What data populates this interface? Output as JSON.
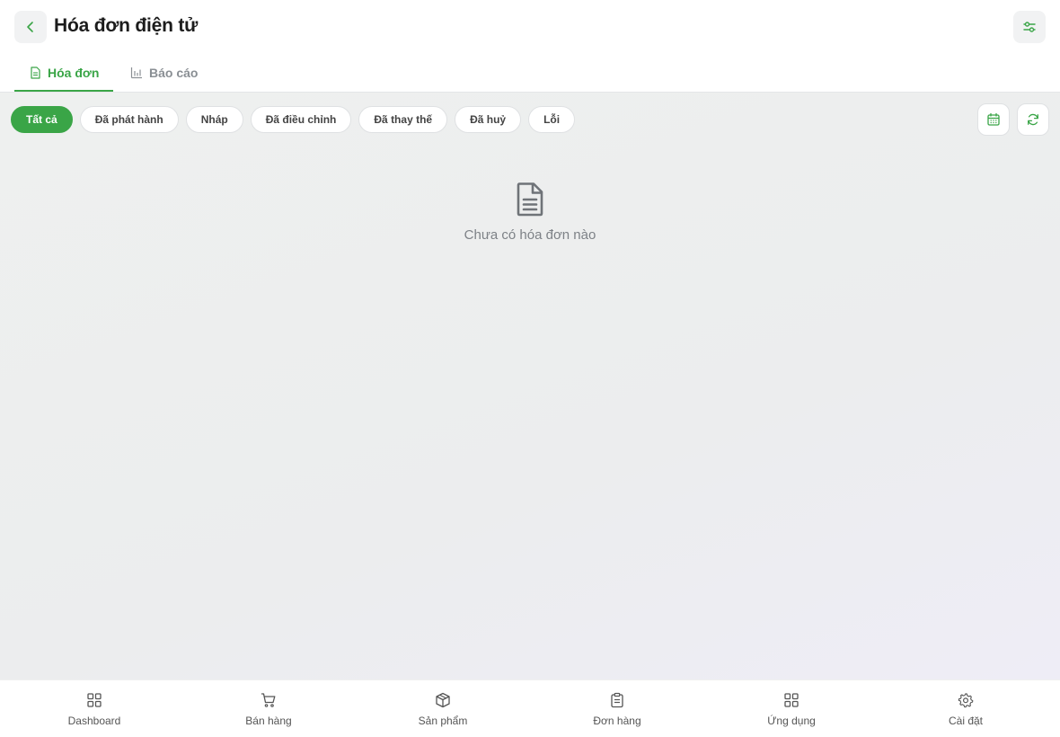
{
  "header": {
    "title": "Hóa đơn điện tử",
    "back_icon": "chevron-left-icon",
    "filter_icon": "sliders-icon"
  },
  "tabs": [
    {
      "label": "Hóa đơn",
      "icon": "document-icon",
      "active": true
    },
    {
      "label": "Báo cáo",
      "icon": "bar-chart-icon",
      "active": false
    }
  ],
  "filters": [
    {
      "label": "Tất cả",
      "active": true
    },
    {
      "label": "Đã phát hành",
      "active": false
    },
    {
      "label": "Nháp",
      "active": false
    },
    {
      "label": "Đã điều chỉnh",
      "active": false
    },
    {
      "label": "Đã thay thế",
      "active": false
    },
    {
      "label": "Đã huỷ",
      "active": false
    },
    {
      "label": "Lỗi",
      "active": false
    }
  ],
  "tools": {
    "calendar_icon": "calendar-icon",
    "refresh_icon": "refresh-icon"
  },
  "empty_state": {
    "icon": "document-icon",
    "message": "Chưa có hóa đơn nào"
  },
  "bottom_nav": [
    {
      "label": "Dashboard",
      "icon": "grid-icon"
    },
    {
      "label": "Bán hàng",
      "icon": "cart-icon"
    },
    {
      "label": "Sản phẩm",
      "icon": "box-icon"
    },
    {
      "label": "Đơn hàng",
      "icon": "clipboard-icon"
    },
    {
      "label": "Ứng dụng",
      "icon": "apps-icon"
    },
    {
      "label": "Cài đặt",
      "icon": "gear-icon"
    }
  ],
  "colors": {
    "accent": "#3aa547",
    "muted_text": "#8a8f94",
    "background": "#eceeee"
  }
}
